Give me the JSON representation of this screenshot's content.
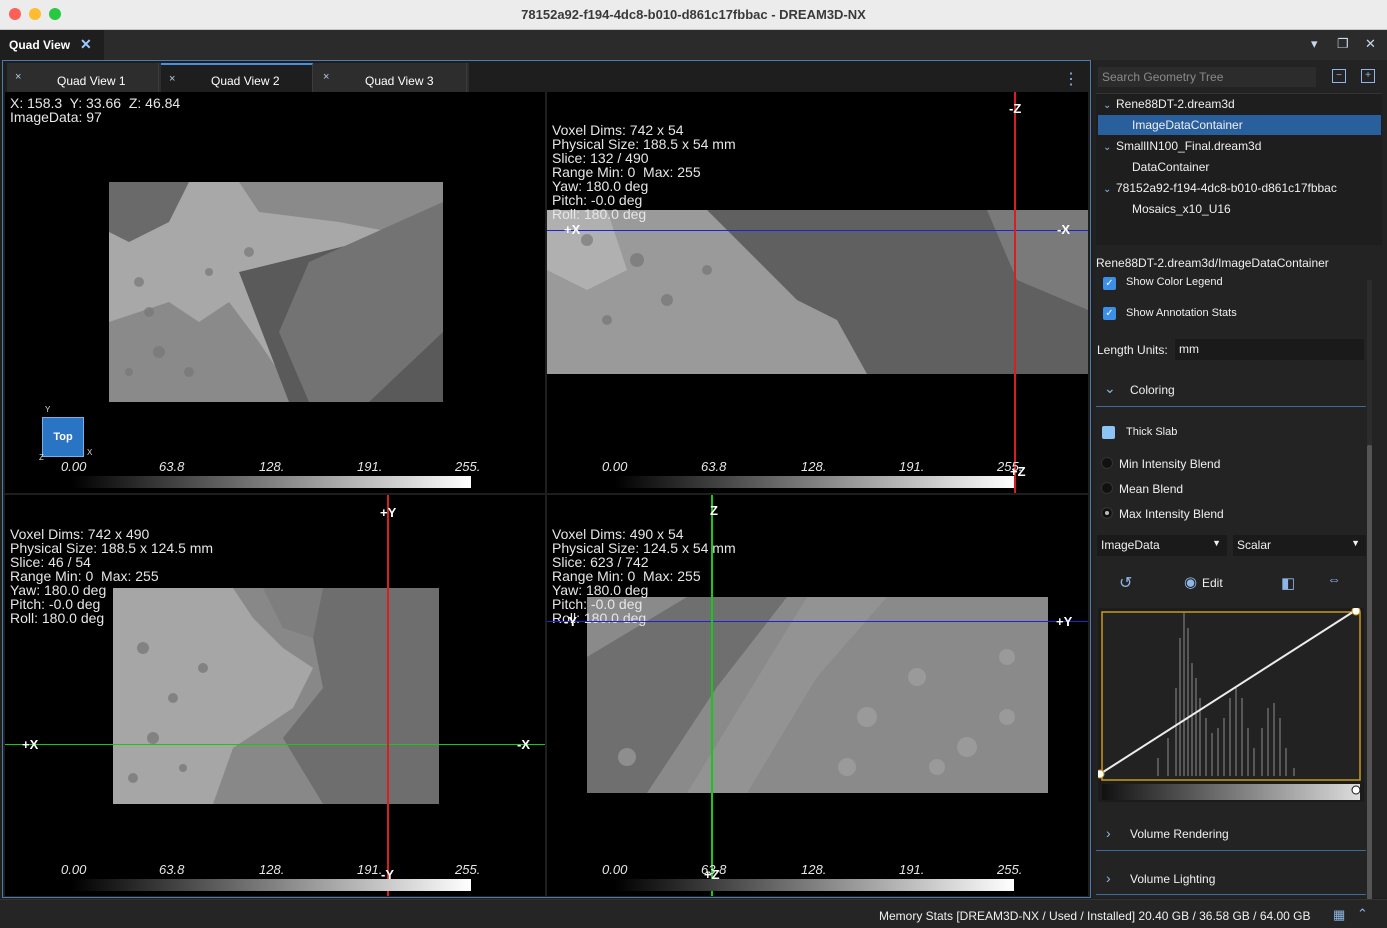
{
  "window": {
    "title": "78152a92-f194-4dc8-b010-d861c17fbbac - DREAM3D-NX",
    "doc_tab": "Quad View",
    "doc_tab_close": "✕",
    "ctl_menu": "▾",
    "ctl_float": "❐",
    "ctl_close": "✕"
  },
  "quad_tabs": [
    {
      "label": "Quad View 1",
      "close": "×"
    },
    {
      "label": "Quad View 2",
      "close": "×"
    },
    {
      "label": "Quad View 3",
      "close": "×"
    }
  ],
  "kebab": "⋮",
  "viewports": {
    "top_left": {
      "info_line1": "X: 158.3  Y: 33.66  Z: 46.84",
      "info_line2": "ImageData: 97",
      "orient_label": "Top",
      "orient_y": "Y",
      "orient_z": "Z",
      "orient_x": "X"
    },
    "top_right": {
      "info": [
        "Voxel Dims: 742 x 54",
        "Physical Size: 188.5 x 54 mm",
        "Slice: 132 / 490",
        "Range Min: 0  Max: 255",
        "Yaw: 180.0 deg",
        "Pitch: -0.0 deg",
        "Roll: 180.0 deg"
      ],
      "axis_top": "-Z",
      "axis_left": "+X",
      "axis_right": "-X",
      "axis_bottom": "+Z"
    },
    "bottom_left": {
      "info": [
        "Voxel Dims: 742 x 490",
        "Physical Size: 188.5 x 124.5 mm",
        "Slice: 46 / 54",
        "Range Min: 0  Max: 255",
        "Yaw: 180.0 deg",
        "Pitch: -0.0 deg",
        "Roll: 180.0 deg"
      ],
      "axis_top": "+Y",
      "axis_left": "+X",
      "axis_right": "-X",
      "axis_bottom": "-Y"
    },
    "bottom_right": {
      "info": [
        "Voxel Dims: 490 x 54",
        "Physical Size: 124.5 x 54 mm",
        "Slice: 623 / 742",
        "Range Min: 0  Max: 255",
        "Yaw: 180.0 deg",
        "Pitch: -0.0 deg",
        "Roll: 180.0 deg"
      ],
      "axis_top": "Z",
      "axis_left": "-Y",
      "axis_right": "+Y",
      "axis_bottom": "+Z"
    }
  },
  "colorbar_ticks": [
    "0.00",
    "63.8",
    "128.",
    "191.",
    "255."
  ],
  "right_panel": {
    "search_placeholder": "Search Geometry Tree",
    "collapse_btn": "−",
    "expand_btn": "+",
    "tree": [
      {
        "label": "Rene88DT-2.dream3d",
        "child": "ImageDataContainer"
      },
      {
        "label": "SmallIN100_Final.dream3d",
        "child": "DataContainer"
      },
      {
        "label": "78152a92-f194-4dc8-b010-d861c17fbbac",
        "child": "Mosaics_x10_U16"
      }
    ],
    "path": "Rene88DT-2.dream3d/ImageDataContainer",
    "show_color_legend": "Show Color Legend",
    "show_annotation_stats": "Show Annotation Stats",
    "length_units_label": "Length Units:",
    "length_units_value": "mm",
    "coloring": "Coloring",
    "thick_slab": "Thick Slab",
    "blend_min": "Min Intensity Blend",
    "blend_mean": "Mean Blend",
    "blend_max": "Max Intensity Blend",
    "array_select": "ImageData",
    "mode_select": "Scalar",
    "edit_label": "Edit",
    "volume_rendering": "Volume Rendering",
    "volume_lighting": "Volume Lighting"
  },
  "status": {
    "memory": "Memory Stats [DREAM3D-NX / Used / Installed] 20.40 GB / 36.58 GB / 64.00 GB"
  },
  "colors": {
    "accent": "#2a74c4",
    "line_red": "#d42020",
    "line_blue": "#2020d8",
    "line_green": "#18c818"
  }
}
